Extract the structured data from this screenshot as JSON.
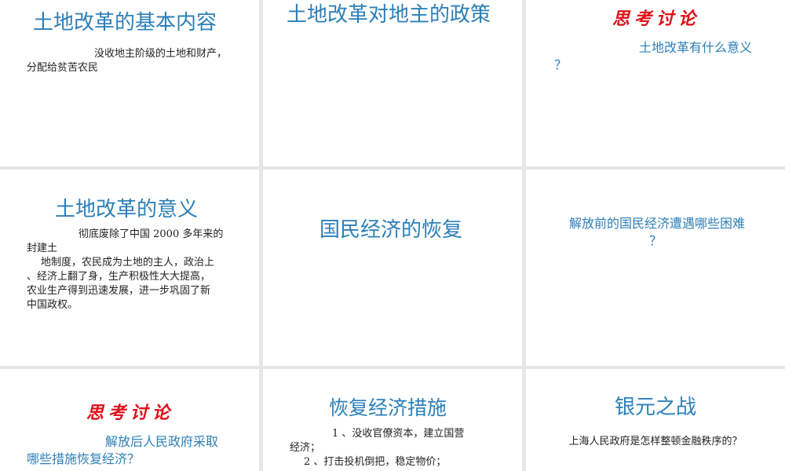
{
  "slides": [
    {
      "title": "土地改革的基本内容",
      "body_line1": "没收地主阶级的土地和财产，",
      "body_line2": "分配给贫苦农民"
    },
    {
      "title": "土地改革对地主的政策"
    },
    {
      "heading": "思考讨论",
      "question_line1": "土地改革有什么意义",
      "question_line2": "？"
    },
    {
      "title": "土地改革的意义",
      "line1": "彻底废除了中国 2000 多年来的",
      "line2": "封建土",
      "line3": "地制度，农民成为土地的主人，政治上",
      "line4": "、经济上翻了身，生产积极性大大提高，",
      "line5": "农业生产得到迅速发展，进一步巩固了新",
      "line6": "中国政权。"
    },
    {
      "title": "国民经济的恢复"
    },
    {
      "question_line1": "解放前的国民经济遭遇哪些困难",
      "question_line2": "？"
    },
    {
      "heading": "思考讨论",
      "question_line1": "解放后人民政府采取",
      "question_line2": "哪些措施恢复经济？"
    },
    {
      "title": "恢复经济措施",
      "line1": "1 、没收官僚资本，建立国营",
      "line2": "经济；",
      "line3": "2 、打击投机倒把，稳定物价；"
    },
    {
      "title": "银元之战",
      "question": "上海人民政府是怎样整顿金融秩序的？"
    }
  ],
  "colors": {
    "title_blue": "#2c7fb8",
    "heading_red": "#e0101a",
    "background_gray": "#e6e6e6"
  }
}
